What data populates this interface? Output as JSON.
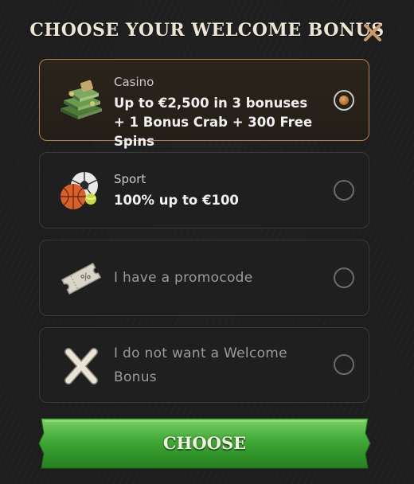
{
  "modal": {
    "title": "CHOOSE YOUR WELCOME BONUS",
    "close_icon": "close-x-icon"
  },
  "options": [
    {
      "category": "Casino",
      "description": "Up to €2,500 in 3 bonuses + 1 Bonus Crab + 300 Free Spins",
      "icon": "money-stack-icon",
      "selected": true
    },
    {
      "category": "Sport",
      "description": "100% up to €100",
      "icon": "sport-balls-icon",
      "selected": false
    },
    {
      "label": "I have a promocode",
      "icon": "coupon-ticket-icon",
      "selected": false
    },
    {
      "label": "I do not want a Welcome Bonus",
      "icon": "cross-icon",
      "selected": false
    }
  ],
  "choose_button": {
    "label": "CHOOSE"
  },
  "colors": {
    "accent_border": "#b2814a",
    "button_green": "#3fa937",
    "title_text": "#ece5d3",
    "close_x": "#c99a66"
  }
}
